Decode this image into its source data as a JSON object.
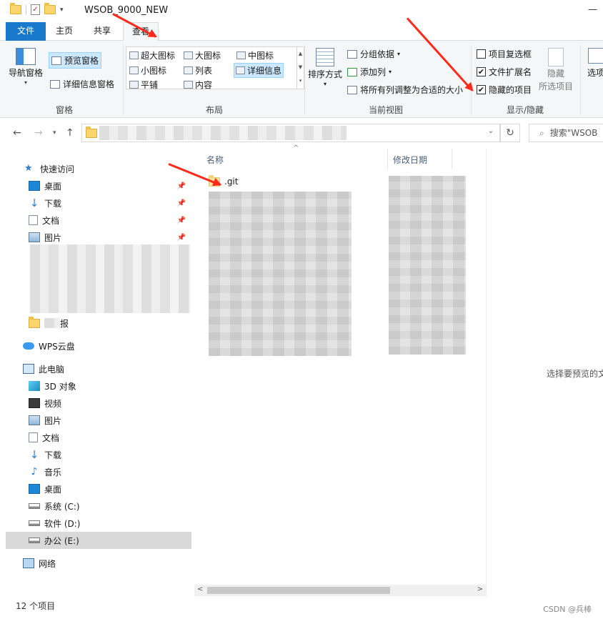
{
  "window": {
    "title": "WSOB_9000_NEW",
    "controls": "—"
  },
  "tabs": [
    {
      "label": "文件"
    },
    {
      "label": "主页"
    },
    {
      "label": "共享"
    },
    {
      "label": "查看"
    }
  ],
  "ribbon": {
    "pane_group": {
      "label": "窗格",
      "nav_pane": "导航窗格",
      "preview_pane": "预览窗格",
      "details_pane": "详细信息窗格"
    },
    "layout_group": {
      "label": "布局",
      "items": [
        "超大图标",
        "大图标",
        "中图标",
        "小图标",
        "列表",
        "详细信息",
        "平铺",
        "内容"
      ],
      "selected": "详细信息"
    },
    "current_view_group": {
      "label": "当前视图",
      "sort": "排序方式",
      "group_by": "分组依据",
      "add_column": "添加列",
      "fit_columns": "将所有列调整为合适的大小"
    },
    "show_hide_group": {
      "label": "显示/隐藏",
      "item_checkboxes": {
        "label": "项目复选框",
        "checked": false
      },
      "file_extensions": {
        "label": "文件扩展名",
        "checked": true
      },
      "hidden_items": {
        "label": "隐藏的项目",
        "checked": true
      },
      "hide_selected_1": "隐藏",
      "hide_selected_2": "所选项目"
    },
    "options_label": "选项"
  },
  "address": {
    "search_placeholder": "搜索\"WSOB"
  },
  "sidebar": {
    "quick_access": "快速访问",
    "quick_items": [
      "桌面",
      "下载",
      "文档",
      "图片"
    ],
    "partial_item": "报",
    "wps": "WPS云盘",
    "this_pc": "此电脑",
    "pc_items": [
      "3D 对象",
      "视频",
      "图片",
      "文档",
      "下载",
      "音乐",
      "桌面",
      "系统 (C:)",
      "软件 (D:)",
      "办公 (E:)"
    ],
    "network": "网络"
  },
  "filelist": {
    "col_name": "名称",
    "col_modified": "修改日期",
    "first_item": ".git"
  },
  "preview": {
    "hint": "选择要预览的文"
  },
  "status": {
    "count": "12 个项目",
    "watermark": "CSDN @兵棒"
  }
}
